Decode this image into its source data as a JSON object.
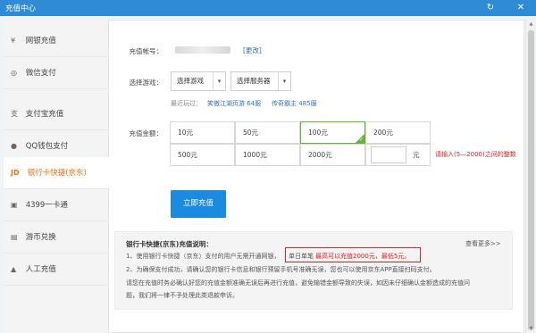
{
  "window": {
    "title": "充值中心",
    "refresh_icon": "refresh-icon",
    "close_icon": "close-icon"
  },
  "sidebar": {
    "items": [
      {
        "label": "网银充值",
        "icon": "¥"
      },
      {
        "label": "微信支付",
        "icon": "◎"
      },
      {
        "label": "支付宝充值",
        "icon": "支"
      },
      {
        "label": "QQ钱包支付",
        "icon": "●"
      },
      {
        "label": "银行卡快捷(京东)",
        "icon": "JD",
        "active": true
      },
      {
        "label": "4399一卡通",
        "icon": "▣"
      },
      {
        "label": "游币兑换",
        "icon": "▤"
      },
      {
        "label": "人工充值",
        "icon": "▲"
      }
    ]
  },
  "form": {
    "account_label": "充值帐号：",
    "change_link": "[更改]",
    "game_label": "选择游戏：",
    "game_select": "选择游戏",
    "server_select": "选择服务器",
    "recent_label": "最近玩过：",
    "recent_games": [
      "笑傲江湖页游 64服",
      "传奇霸主 485服"
    ],
    "amount_label": "充值金额：",
    "amounts": [
      "10元",
      "50元",
      "100元",
      "200元",
      "500元",
      "1000元",
      "2000元"
    ],
    "selected_amount": "100元",
    "custom_unit": "元",
    "custom_hint": "请输入(5—2000)之间的整数",
    "submit": "立即充值"
  },
  "notice": {
    "title": "银行卡快捷(京东)充值说明：",
    "more": "查看更多>>",
    "line1_prefix": "1、使用银行卡快捷（京东）支付的用户无需开通网银，",
    "line1_a": "单日单笔",
    "line1_b": "最高可以充值2000元，最低5元。",
    "line2": "2、为确保支付成功，请确认您的银行卡信息和银行预留手机号准确无误，您也可以使用京东APP直接扫码支付。",
    "line3": "请您在充值时务必确认好您的充值金额准确无误后再进行充值，避免输错金额导致的失误，如因未仔细确认金额造成的充值问",
    "line4": "题，我们将一律不予处理此类退款申诉。"
  },
  "colors": {
    "titlebar": "#2f8bd6",
    "accent": "#e87214",
    "primary": "#1a8be0",
    "selected": "#66b43a",
    "warning": "#e02020",
    "link": "#2f72c4"
  }
}
